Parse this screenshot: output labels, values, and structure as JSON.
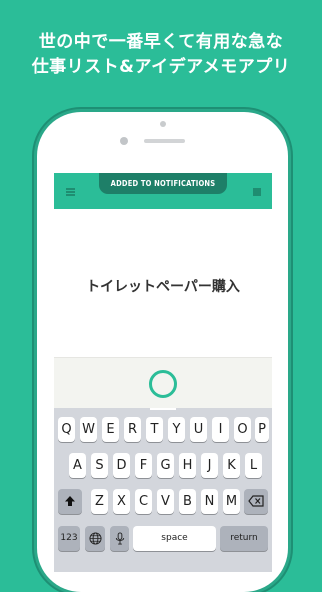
{
  "headline": {
    "line1": "世の中で一番早くて有用な急な",
    "line2": "仕事リスト&アイデアメモアプリ"
  },
  "toast": {
    "text": "ADDED TO NOTIFICATIONS"
  },
  "task": {
    "text": "トイレットペーパー購入"
  },
  "keyboard": {
    "row1": [
      "Q",
      "W",
      "E",
      "R",
      "T",
      "Y",
      "U",
      "I",
      "O",
      "P"
    ],
    "row2": [
      "A",
      "S",
      "D",
      "F",
      "G",
      "H",
      "J",
      "K",
      "L"
    ],
    "row3": [
      "Z",
      "X",
      "C",
      "V",
      "B",
      "N",
      "M"
    ],
    "numbers_label": "123",
    "space_label": "space",
    "return_label": "return"
  },
  "colors": {
    "brand": "#2bbd98",
    "brand_dark": "#1e7f68",
    "keyboard_bg": "#d3d6dc"
  },
  "icons": [
    "menu-icon",
    "square-icon",
    "shift-icon",
    "globe-icon",
    "mic-icon",
    "backspace-icon"
  ]
}
